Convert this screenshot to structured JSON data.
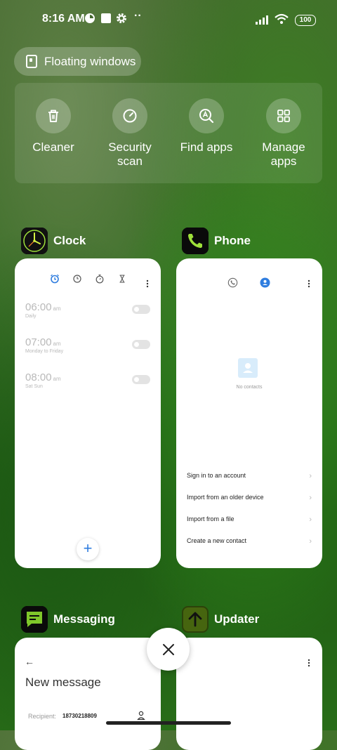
{
  "status_bar": {
    "time": "8:16 AM",
    "battery": "100",
    "overflow": "··"
  },
  "floating_windows": {
    "label": "Floating windows"
  },
  "quick_actions": [
    {
      "label": "Cleaner",
      "icon": "trash-icon"
    },
    {
      "label": "Security scan",
      "icon": "security-scan-icon"
    },
    {
      "label": "Find apps",
      "icon": "find-apps-icon"
    },
    {
      "label": "Manage apps",
      "icon": "manage-apps-icon"
    }
  ],
  "recent_apps": {
    "clock": {
      "name": "Clock",
      "alarms": [
        {
          "time": "06:00",
          "ampm": "am",
          "repeat": "Daily"
        },
        {
          "time": "07:00",
          "ampm": "am",
          "repeat": "Monday to Friday"
        },
        {
          "time": "08:00",
          "ampm": "am",
          "repeat": "Sat Sun"
        }
      ],
      "fab": "+"
    },
    "phone": {
      "name": "Phone",
      "empty_text": "No contacts",
      "links": [
        "Sign in to an account",
        "Import from an older device",
        "Import from a file",
        "Create a new contact"
      ]
    },
    "messaging": {
      "name": "Messaging",
      "back": "←",
      "title": "New message",
      "recipient_label": "Recipient:",
      "recipient_value": "18730218809"
    },
    "updater": {
      "name": "Updater"
    }
  },
  "colors": {
    "accent_blue": "#2f7ddf",
    "messaging_green": "#7fc72a",
    "updater_green": "#3d5a0c"
  }
}
